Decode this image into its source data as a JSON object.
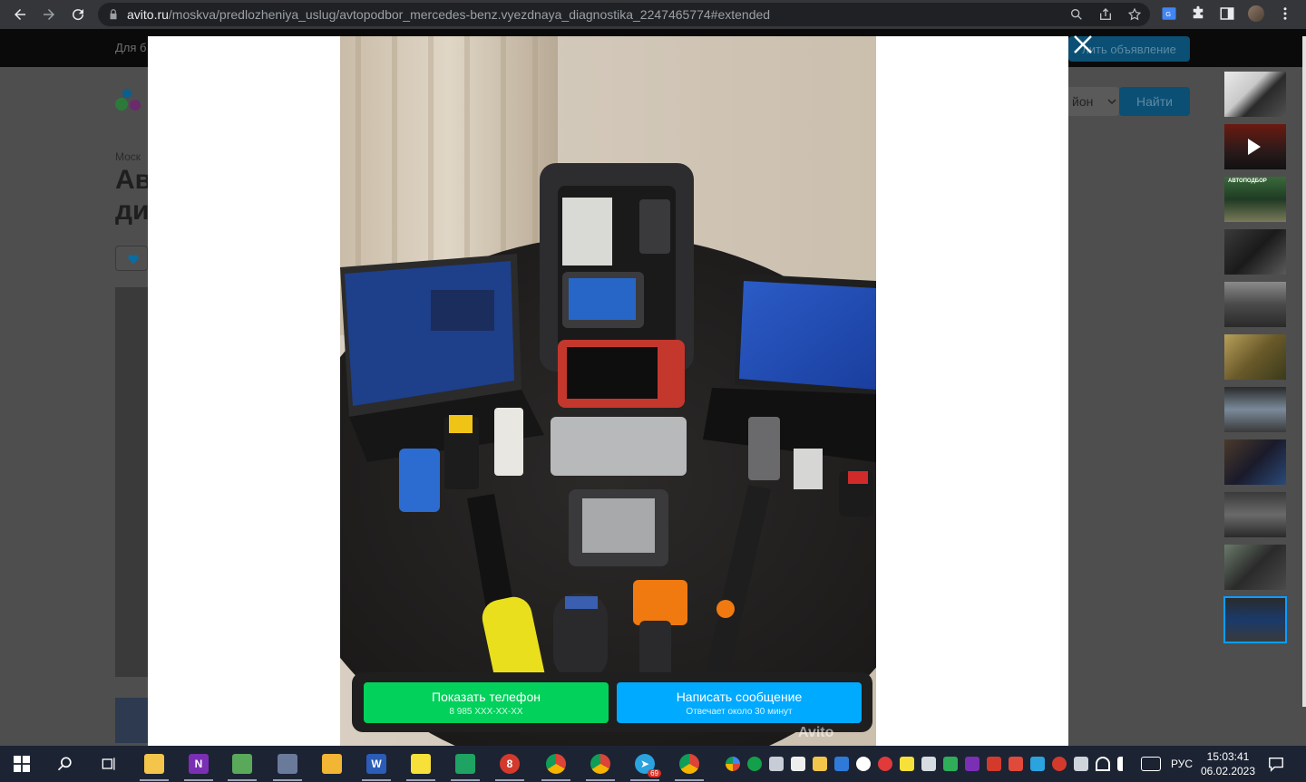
{
  "browser": {
    "url_host": "avito.ru",
    "url_path": "/moskva/predlozheniya_uslug/avtopodbor_mercedes-benz.vyezdnaya_diagnostika_2247465774#extended"
  },
  "page": {
    "topbar_text": "Для б",
    "post_ad_label": "лить объявление",
    "breadcrumb": "Моск",
    "title_partial": "Ав ди",
    "region_select": "йон",
    "find_button": "Найти"
  },
  "lightbox": {
    "show_phone_label": "Показать телефон",
    "phone_masked": "8 985 XXX-XX-XX",
    "write_message_label": "Написать сообщение",
    "response_time": "Отвечает около 30 минут",
    "watermark": "Avito"
  },
  "thumbnails": {
    "count": 11,
    "active_index": 10,
    "captions": [
      "",
      "",
      "АВТОПОДБОР",
      "",
      "",
      "",
      "",
      "",
      "",
      "",
      ""
    ],
    "video_index": 1
  },
  "taskbar": {
    "language": "РУС",
    "time": "15:03:41",
    "date": "06.02.2023",
    "telegram_badge": "69"
  }
}
